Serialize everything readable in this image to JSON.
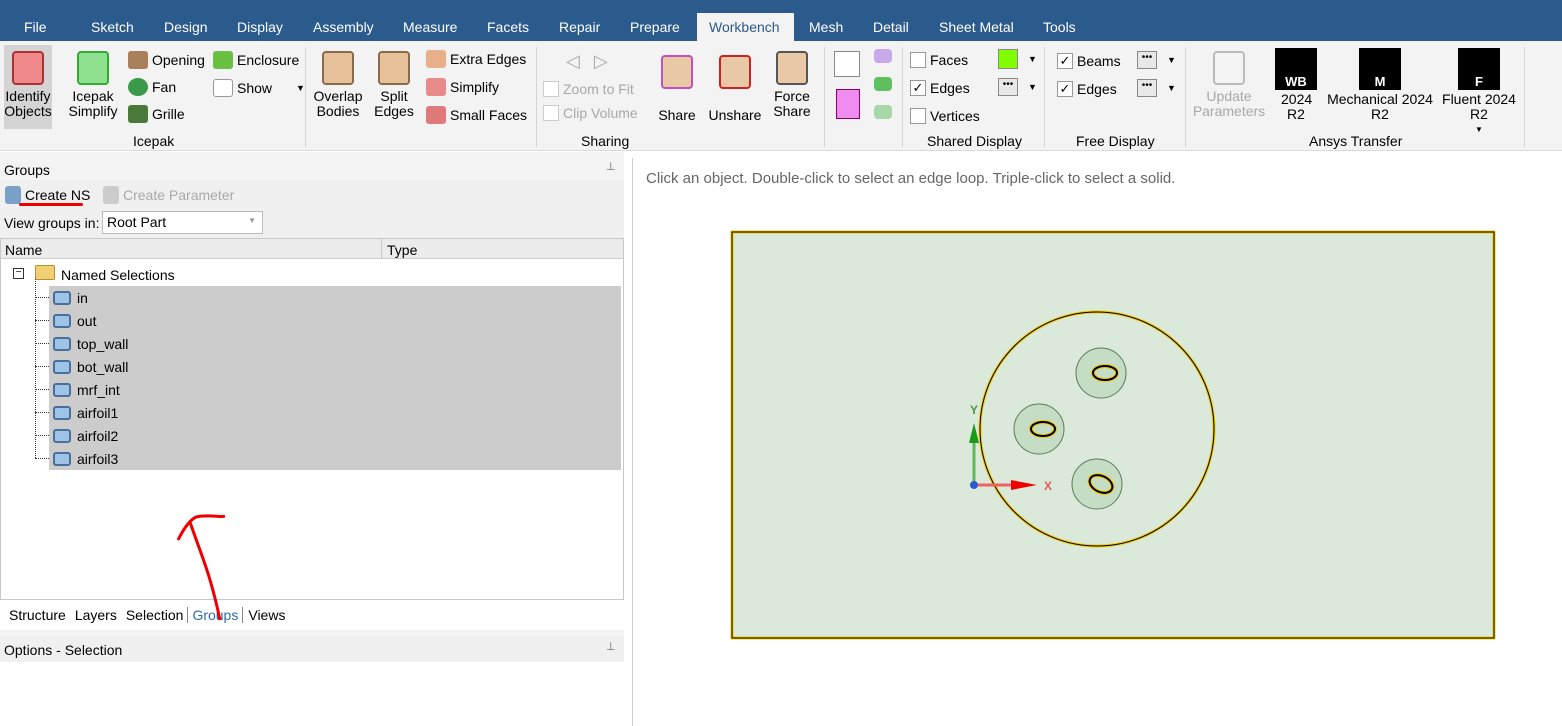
{
  "menu": {
    "items": [
      "File",
      "Sketch",
      "Design",
      "Display",
      "Assembly",
      "Measure",
      "Facets",
      "Repair",
      "Prepare",
      "Workbench",
      "Mesh",
      "Detail",
      "Sheet Metal",
      "Tools"
    ],
    "active": "Workbench"
  },
  "ribbon": {
    "icepak": {
      "identify": "Identify Objects",
      "icepak_simplify": "Icepak Simplify",
      "opening": "Opening",
      "fan": "Fan",
      "grille": "Grille",
      "enclosure": "Enclosure",
      "show": "Show",
      "group": "Icepak"
    },
    "sharing": {
      "overlap": "Overlap Bodies",
      "split": "Split Edges",
      "extra": "Extra Edges",
      "simplify": "Simplify",
      "small": "Small Faces",
      "zoom": "Zoom to Fit",
      "clip": "Clip Volume",
      "share": "Share",
      "unshare": "Unshare",
      "force": "Force Share",
      "group": "Sharing"
    },
    "shared_display": {
      "faces": "Faces",
      "edges": "Edges",
      "vertices": "Vertices",
      "group": "Shared Display",
      "faces_color": "#80ff00"
    },
    "free_display": {
      "beams": "Beams",
      "edges": "Edges",
      "group": "Free Display"
    },
    "transfer": {
      "update": "Update Parameters",
      "wb": "2024 R2",
      "wb_logo": "WB",
      "mech": "Mechanical 2024 R2",
      "mech_logo": "M",
      "fluent": "Fluent 2024 R2",
      "fluent_logo": "F",
      "group": "Ansys Transfer"
    }
  },
  "groups": {
    "title": "Groups",
    "create_ns": "Create NS",
    "create_param": "Create Parameter",
    "view_label": "View groups in:",
    "view_value": "Root Part",
    "col_name": "Name",
    "col_type": "Type",
    "folder": "Named Selections",
    "items": [
      "in",
      "out",
      "top_wall",
      "bot_wall",
      "mrf_int",
      "airfoil1",
      "airfoil2",
      "airfoil3"
    ]
  },
  "tabs": [
    "Structure",
    "Layers",
    "Selection",
    "Groups",
    "Views"
  ],
  "active_tab": "Groups",
  "options": {
    "title": "Options - Selection"
  },
  "viewport": {
    "hint": "Click an object. Double-click to select an edge loop. Triple-click to select a solid.",
    "axis_x": "X",
    "axis_y": "Y"
  }
}
